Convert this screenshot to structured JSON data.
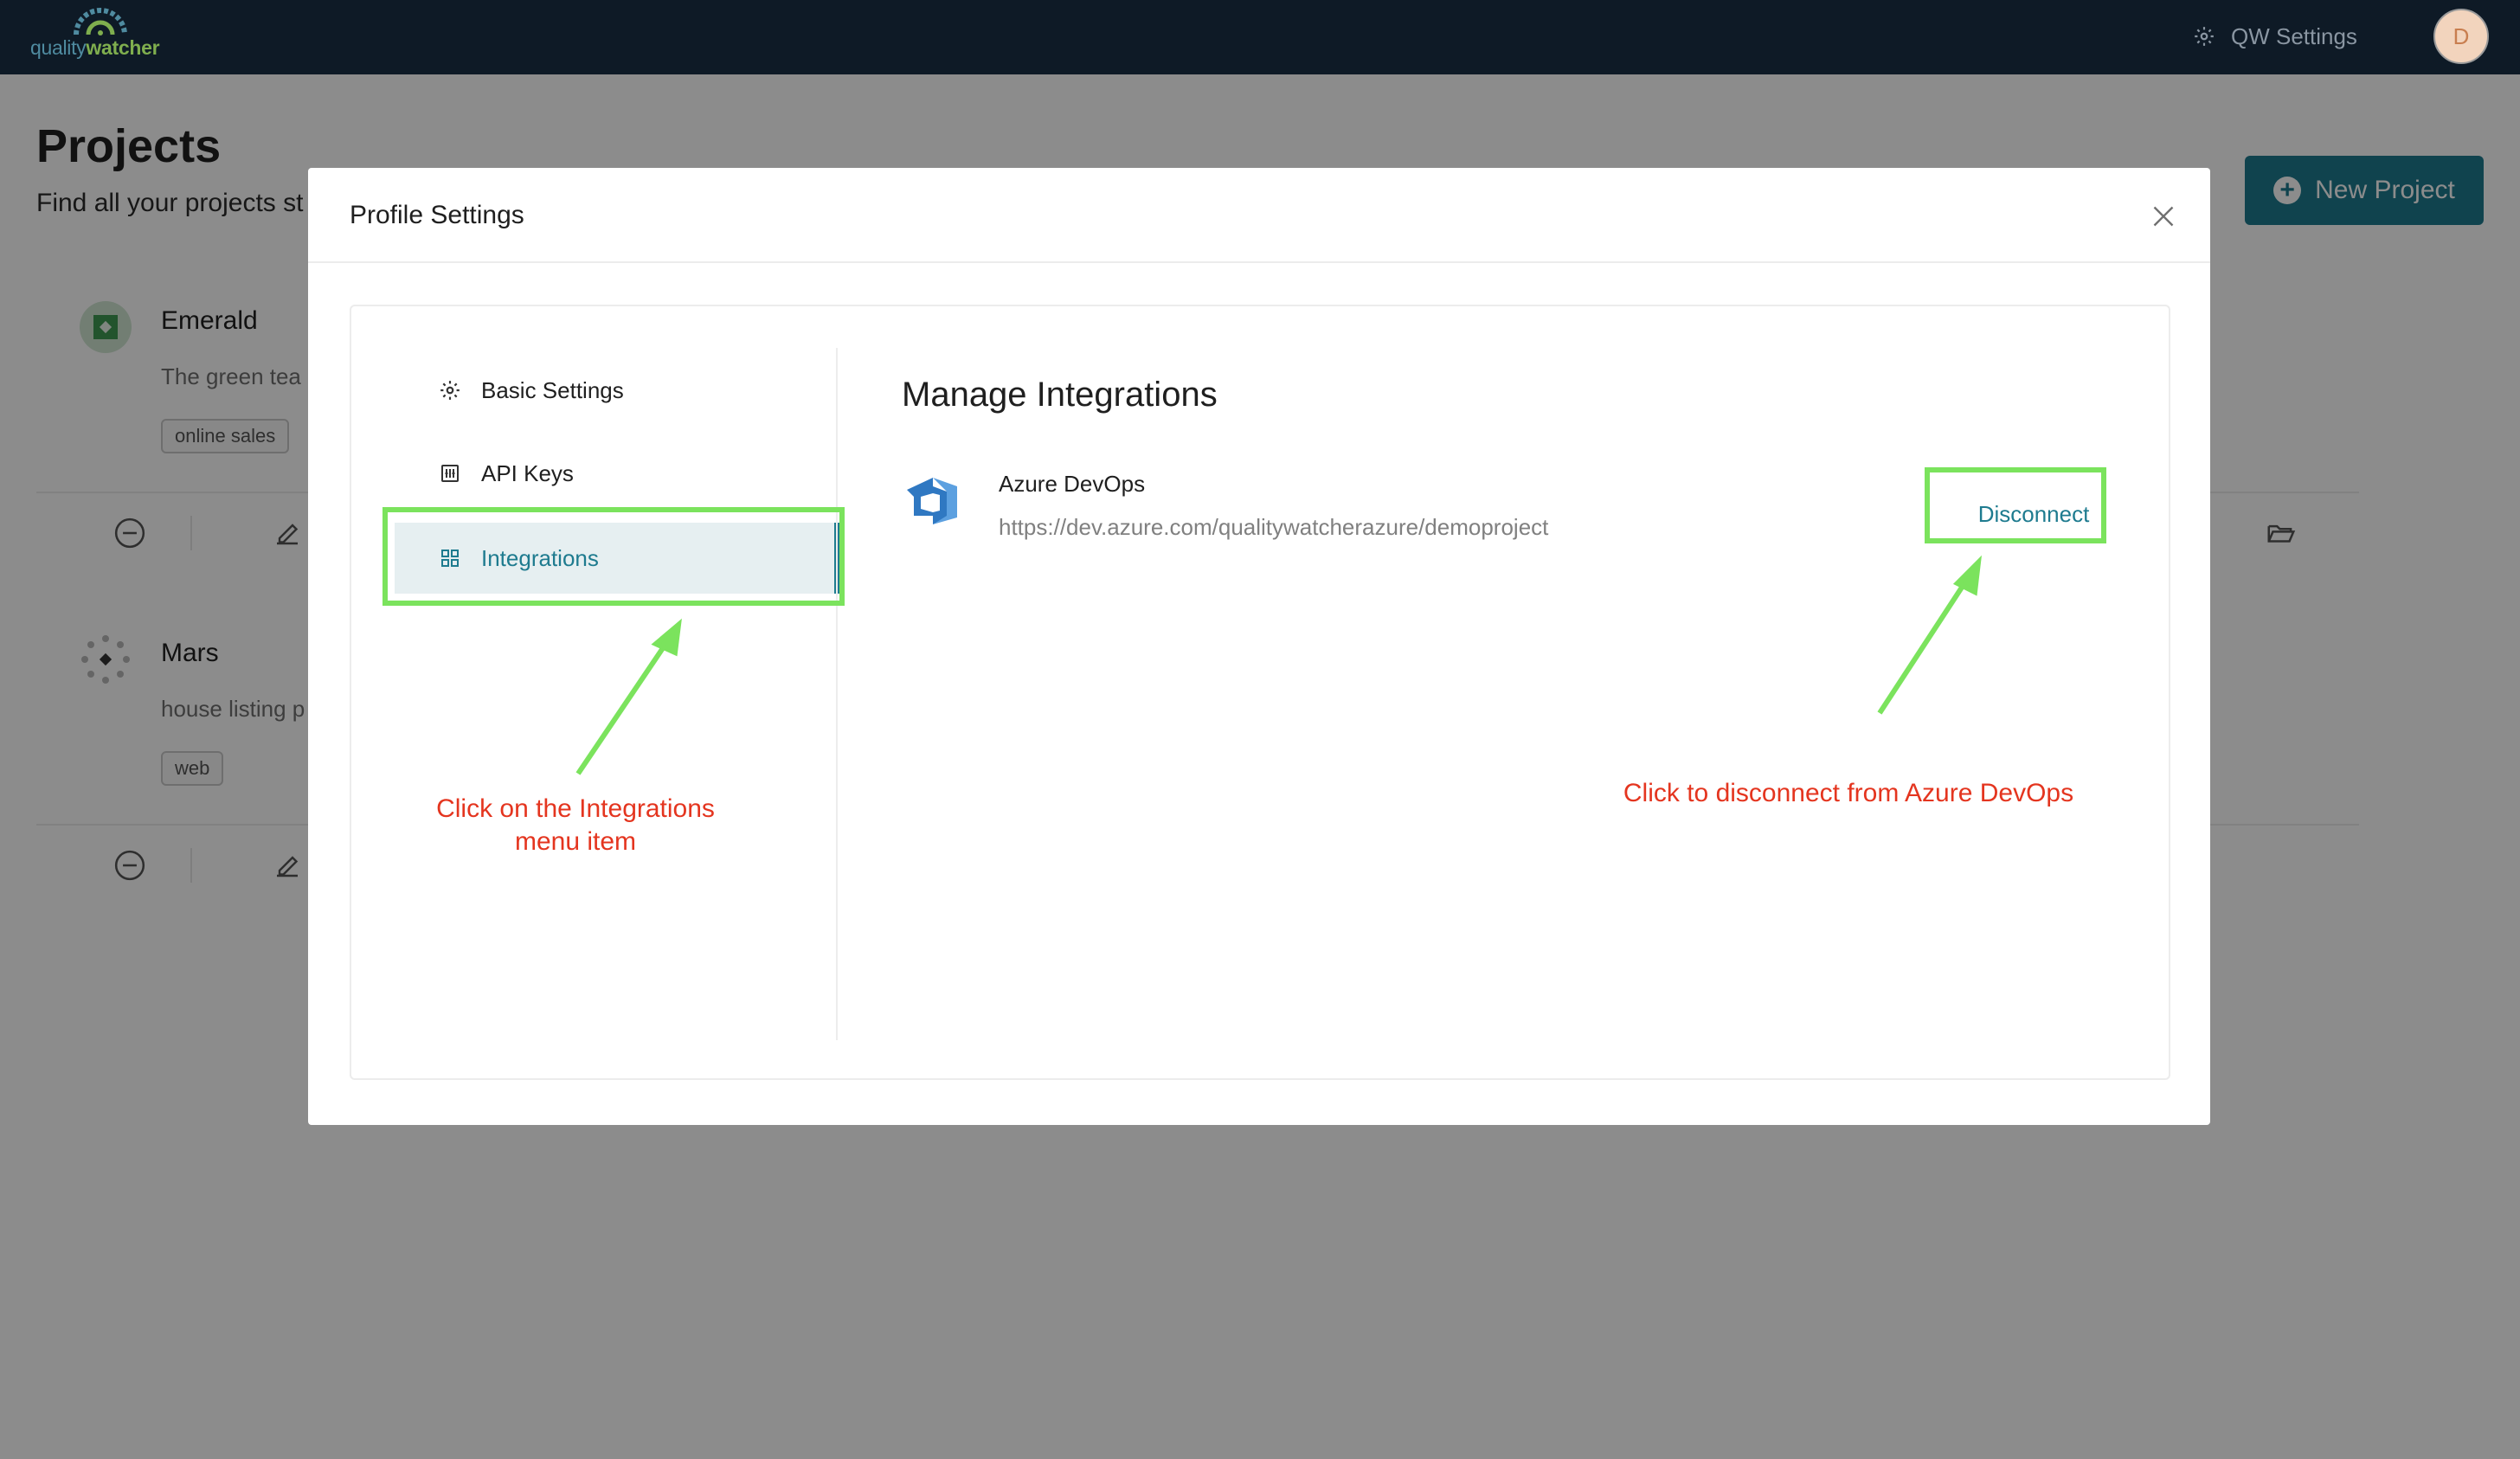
{
  "topbar": {
    "logo": {
      "part1": "quality",
      "part2": "watcher"
    },
    "settings_label": "QW Settings",
    "avatar_initial": "D"
  },
  "page": {
    "title": "Projects",
    "subtitle": "Find all your projects st",
    "new_project_label": "New Project"
  },
  "projects": [
    {
      "name": "Emerald",
      "description": "The green tea",
      "tag": "online sales"
    },
    {
      "name": "Mars",
      "description": "house listing p",
      "tag": "web"
    }
  ],
  "modal": {
    "title": "Profile Settings",
    "menu": [
      {
        "label": "Basic Settings",
        "icon": "gear-icon"
      },
      {
        "label": "API Keys",
        "icon": "api-key-icon"
      },
      {
        "label": "Integrations",
        "icon": "grid-icon",
        "active": true
      }
    ],
    "content": {
      "title": "Manage Integrations",
      "integration": {
        "name": "Azure DevOps",
        "url": "https://dev.azure.com/qualitywatcherazure/demoproject",
        "action_label": "Disconnect"
      }
    }
  },
  "annotations": {
    "note_1": "Click on the Integrations menu item",
    "note_2": "Click to disconnect from Azure DevOps"
  },
  "colors": {
    "topbar": "#0e1a26",
    "accent": "#1e7b8f",
    "highlight": "#7be35d",
    "annotation_text": "#e4351f"
  }
}
